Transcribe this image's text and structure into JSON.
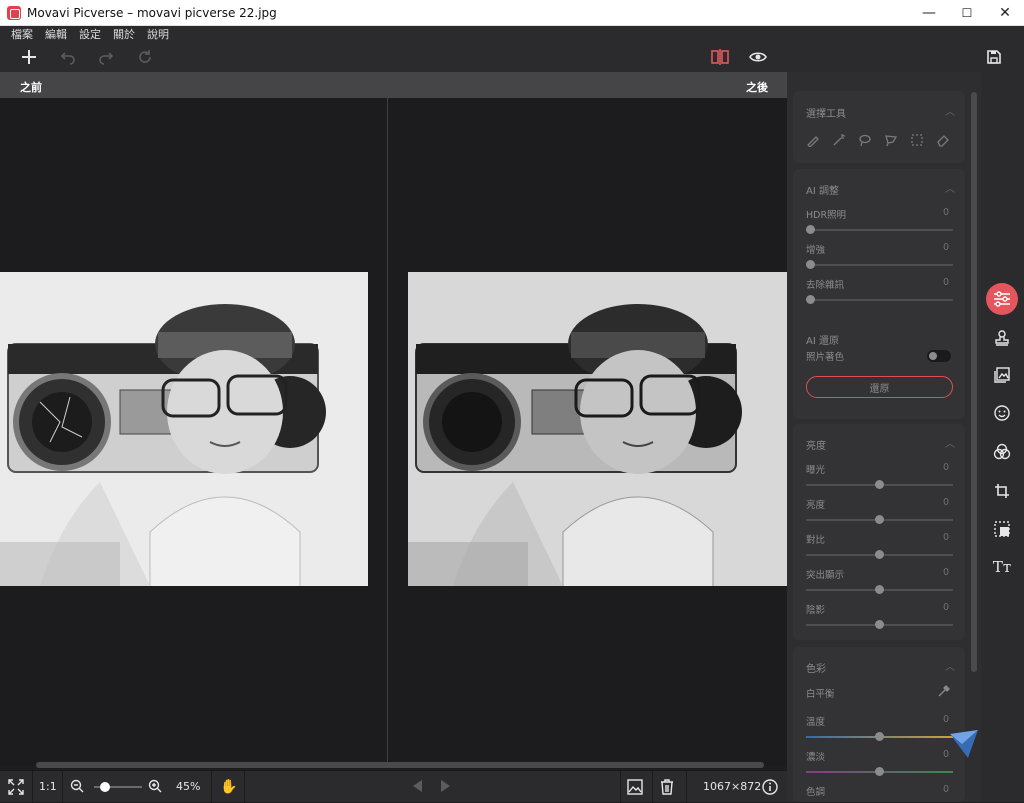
{
  "window": {
    "title": "Movavi Picverse – movavi picverse 22.jpg",
    "minimize": "—",
    "maximize": "☐",
    "close": "✕"
  },
  "menu": [
    "檔案",
    "編輯",
    "設定",
    "關於",
    "說明"
  ],
  "compare": {
    "before_label": "之前",
    "after_label": "之後"
  },
  "bottom": {
    "fit_label": "1:1",
    "zoom_percent": "45%",
    "zoom_level": 0.15,
    "image_size": "1067×872"
  },
  "panel": {
    "selection_tools": {
      "title": "選擇工具"
    },
    "ai_adjust": {
      "title": "AI 調整",
      "rows": [
        {
          "label": "HDR照明",
          "value": "0",
          "level": 0
        },
        {
          "label": "增強",
          "value": "0",
          "level": 0
        },
        {
          "label": "去除雜訊",
          "value": "0",
          "level": 0
        }
      ]
    },
    "ai_restore": {
      "title": "AI 還原",
      "colorize_label": "照片著色",
      "restore_button": "還原"
    },
    "brightness": {
      "title": "亮度",
      "rows": [
        {
          "label": "曝光",
          "value": "0",
          "level": 0.5
        },
        {
          "label": "亮度",
          "value": "0",
          "level": 0.5
        },
        {
          "label": "對比",
          "value": "0",
          "level": 0.5
        },
        {
          "label": "突出顯示",
          "value": "0",
          "level": 0.5
        },
        {
          "label": "陰影",
          "value": "0",
          "level": 0.5
        }
      ]
    },
    "color": {
      "title": "色彩",
      "white_balance_label": "白平衡",
      "rows": [
        {
          "label": "溫度",
          "value": "0",
          "level": 0.5
        },
        {
          "label": "濃淡",
          "value": "0",
          "level": 0.5
        },
        {
          "label": "色調",
          "value": "0",
          "level": 0.5
        }
      ]
    }
  },
  "colors": {
    "accent": "#e4565e",
    "panel_bg": "#333336",
    "canvas_bg": "#1c1c1e"
  }
}
